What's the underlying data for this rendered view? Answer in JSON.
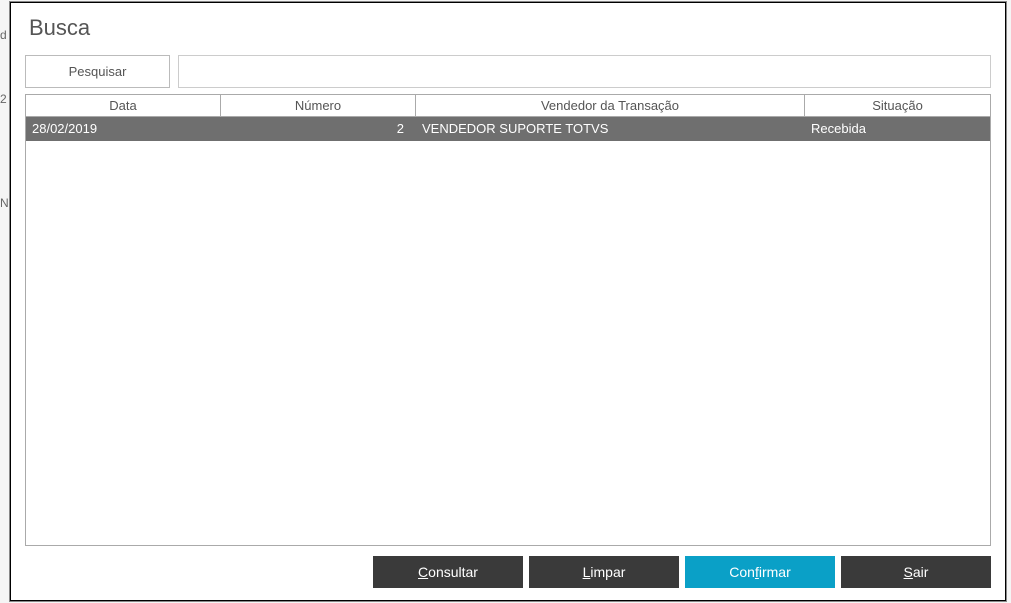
{
  "title": "Busca",
  "search": {
    "button_label": "Pesquisar",
    "input_value": ""
  },
  "grid": {
    "headers": {
      "data": "Data",
      "numero": "Número",
      "vendedor": "Vendedor da Transação",
      "situacao": "Situação"
    },
    "rows": [
      {
        "data": "28/02/2019",
        "numero": "2",
        "vendedor": "VENDEDOR SUPORTE TOTVS",
        "situacao": "Recebida"
      }
    ]
  },
  "footer": {
    "consultar_pre": "",
    "consultar_key": "C",
    "consultar_post": "onsultar",
    "limpar_pre": "",
    "limpar_key": "L",
    "limpar_post": "impar",
    "confirmar_pre": "Con",
    "confirmar_key": "f",
    "confirmar_post": "irmar",
    "sair_pre": "",
    "sair_key": "S",
    "sair_post": "air"
  },
  "bg": {
    "c1": "d",
    "c2": "2",
    "c3": "N"
  }
}
